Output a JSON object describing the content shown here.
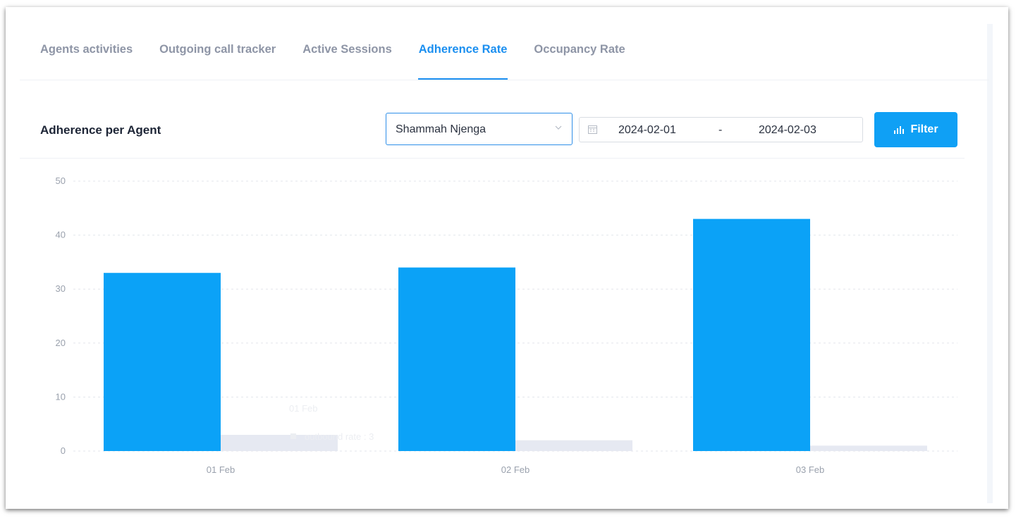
{
  "tabs": [
    {
      "label": "Agents activities",
      "active": false
    },
    {
      "label": "Outgoing call tracker",
      "active": false
    },
    {
      "label": "Active Sessions",
      "active": false
    },
    {
      "label": "Adherence Rate",
      "active": true
    },
    {
      "label": "Occupancy Rate",
      "active": false
    }
  ],
  "panel": {
    "title": "Adherence per Agent",
    "agent_select": {
      "value": "Shammah Njenga",
      "icon": "chevron-down-icon"
    },
    "date_range": {
      "start": "2024-02-01",
      "separator": "-",
      "end": "2024-02-03",
      "icon": "calendar-icon"
    },
    "filter_button": {
      "label": "Filter",
      "icon": "bar-chart-icon"
    }
  },
  "tooltip_ghost": {
    "title": "01 Feb",
    "line": "outbound rate : 3"
  },
  "colors": {
    "accent": "#1b8ff0",
    "primary_bar": "#0ba2f7",
    "secondary_bar": "#e6e9f2",
    "filter_button": "#0fa0f5"
  },
  "chart_data": {
    "type": "bar",
    "categories": [
      "01 Feb",
      "02 Feb",
      "03 Feb"
    ],
    "series": [
      {
        "values": [
          33,
          34,
          43
        ],
        "color": "#0ba2f7"
      },
      {
        "values": [
          3,
          2,
          1
        ],
        "color": "#e6e9f2"
      }
    ],
    "yticks": [
      0,
      10,
      20,
      30,
      40,
      50
    ],
    "ylim": [
      0,
      50
    ],
    "grid": true,
    "title": "",
    "xlabel": "",
    "ylabel": ""
  }
}
